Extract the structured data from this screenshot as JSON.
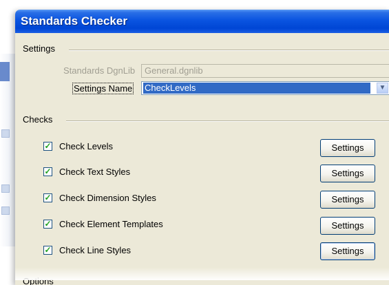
{
  "dialog": {
    "title": "Standards Checker"
  },
  "settings_group": {
    "label": "Settings",
    "dgnlib_label": "Standards DgnLib",
    "dgnlib_value": "General.dgnlib",
    "name_label": "Settings Name",
    "name_value": "CheckLevels"
  },
  "checks_group": {
    "label": "Checks",
    "items": [
      {
        "label": "Check Levels",
        "checked": true,
        "button": "Settings"
      },
      {
        "label": "Check Text Styles",
        "checked": true,
        "button": "Settings"
      },
      {
        "label": "Check Dimension Styles",
        "checked": true,
        "button": "Settings"
      },
      {
        "label": "Check Element Templates",
        "checked": true,
        "button": "Settings"
      },
      {
        "label": "Check Line Styles",
        "checked": true,
        "button": "Settings"
      }
    ]
  },
  "options_group": {
    "label": "Options"
  },
  "colors": {
    "titlebar": "#0a54e0",
    "dialog_bg": "#ece9d8",
    "selection": "#316ac5",
    "check_mark": "#21a121"
  }
}
